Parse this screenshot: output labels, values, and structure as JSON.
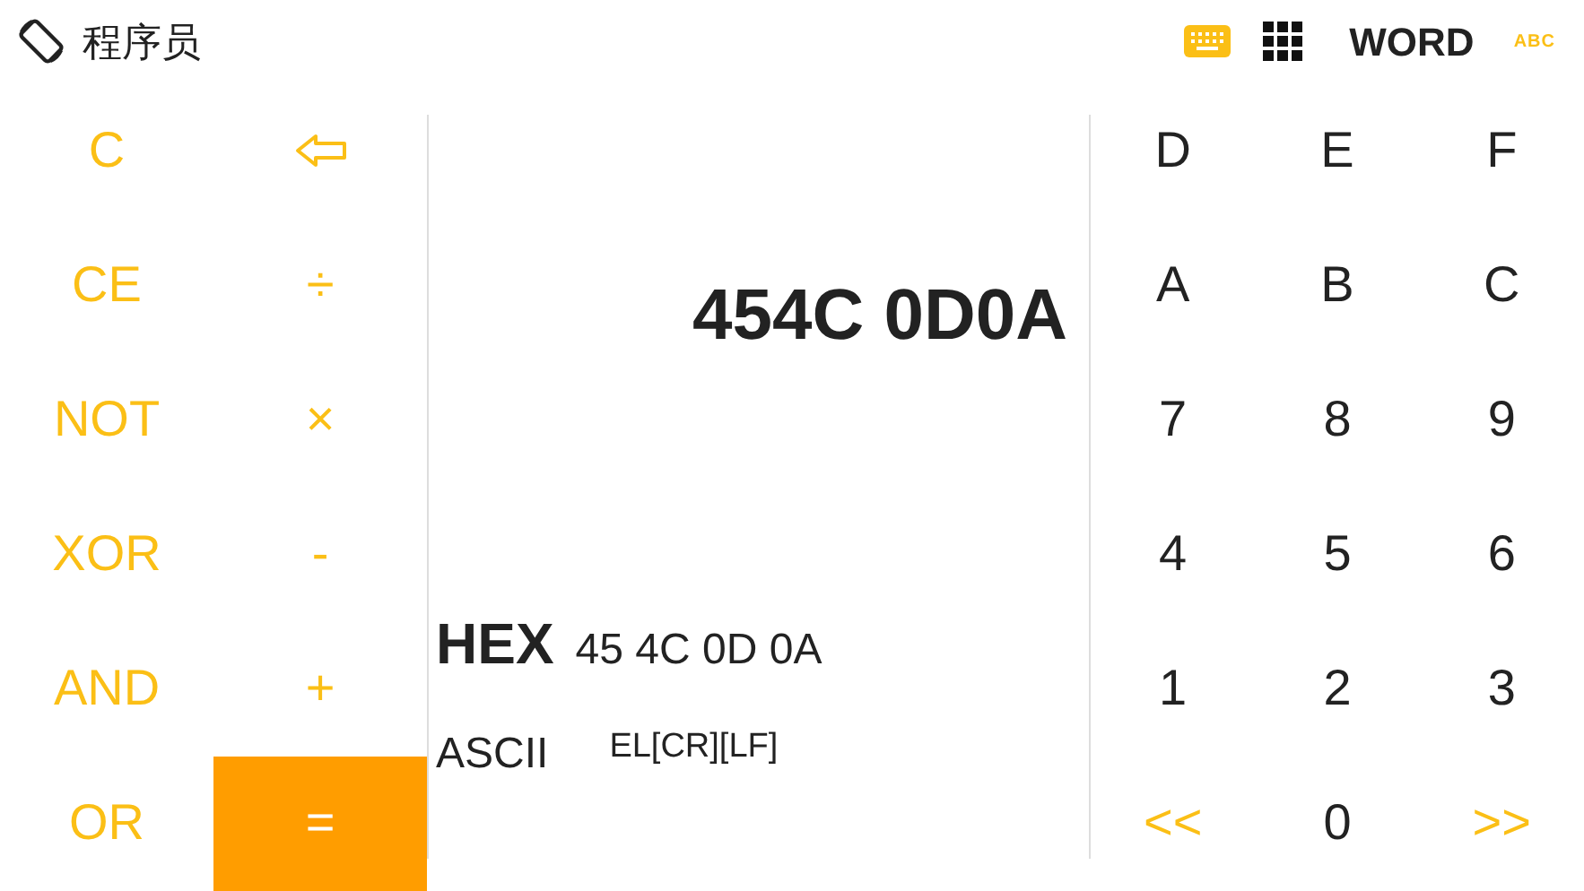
{
  "header": {
    "title": "程序员",
    "word_size": "WORD",
    "abc_label": "ABC"
  },
  "operator_keys": [
    {
      "kind": "text",
      "label": "C",
      "highlighted": false
    },
    {
      "kind": "backspace",
      "highlighted": false
    },
    {
      "kind": "text",
      "label": "CE",
      "highlighted": false
    },
    {
      "kind": "text",
      "label": "÷",
      "highlighted": false
    },
    {
      "kind": "text",
      "label": "NOT",
      "highlighted": false
    },
    {
      "kind": "text",
      "label": "×",
      "highlighted": false
    },
    {
      "kind": "text",
      "label": "XOR",
      "highlighted": false
    },
    {
      "kind": "text",
      "label": "-",
      "highlighted": false
    },
    {
      "kind": "text",
      "label": "AND",
      "highlighted": false
    },
    {
      "kind": "text",
      "label": "+",
      "highlighted": false
    },
    {
      "kind": "text",
      "label": "OR",
      "highlighted": false
    },
    {
      "kind": "text",
      "label": "=",
      "highlighted": true
    }
  ],
  "display": {
    "value": "454C 0D0A",
    "hex_label": "HEX",
    "hex_value": "45 4C 0D 0A",
    "ascii_label": "ASCII",
    "ascii_value": "EL[CR][LF]"
  },
  "digit_keys": [
    {
      "label": "D",
      "accent": false
    },
    {
      "label": "E",
      "accent": false
    },
    {
      "label": "F",
      "accent": false
    },
    {
      "label": "A",
      "accent": false
    },
    {
      "label": "B",
      "accent": false
    },
    {
      "label": "C",
      "accent": false
    },
    {
      "label": "7",
      "accent": false
    },
    {
      "label": "8",
      "accent": false
    },
    {
      "label": "9",
      "accent": false
    },
    {
      "label": "4",
      "accent": false
    },
    {
      "label": "5",
      "accent": false
    },
    {
      "label": "6",
      "accent": false
    },
    {
      "label": "1",
      "accent": false
    },
    {
      "label": "2",
      "accent": false
    },
    {
      "label": "3",
      "accent": false
    },
    {
      "label": "<<",
      "accent": true
    },
    {
      "label": "0",
      "accent": false
    },
    {
      "label": ">>",
      "accent": true
    }
  ]
}
